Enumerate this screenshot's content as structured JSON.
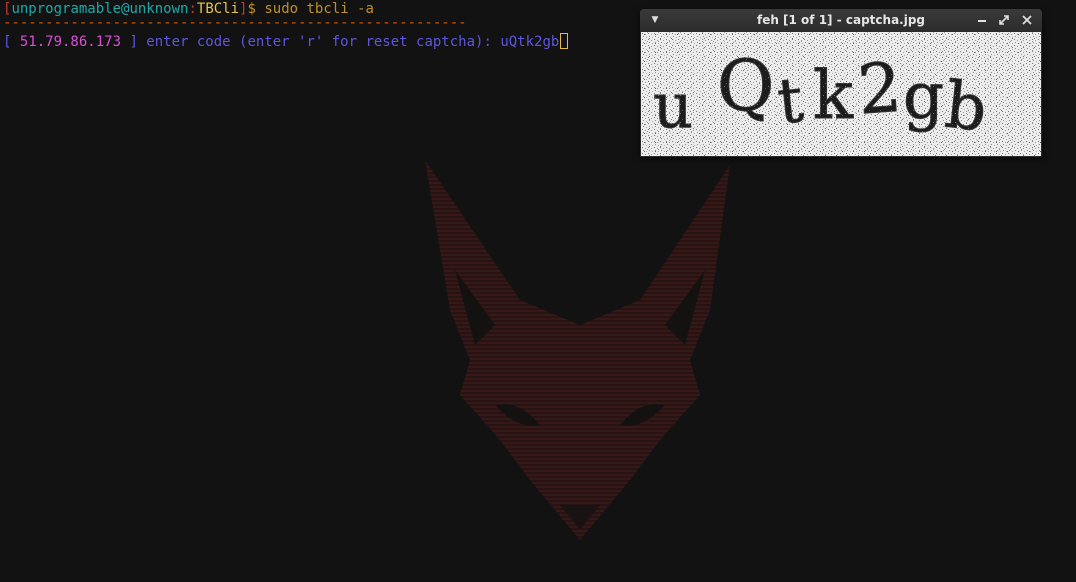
{
  "terminal": {
    "prompt_open_bracket": "[",
    "prompt_user_host": "unprogramable@unknown",
    "prompt_colon": ":",
    "prompt_dir": "TBCli",
    "prompt_close_bracket": "]",
    "prompt_symbol": "$",
    "command": " sudo tbcli -a",
    "separator": "-------------------------------------------------------",
    "ip_open": "[ ",
    "ip_address": "51.79.86.173",
    "ip_close": " ]",
    "prompt_text": " enter code (enter 'r' for reset captcha): ",
    "input_value": "uQtk2gb"
  },
  "feh_window": {
    "title": "feh [1 of 1] - captcha.jpg",
    "menu_icon": "triangle-down",
    "minimize_icon": "minimize",
    "maximize_icon": "maximize",
    "close_icon": "close"
  },
  "captcha": {
    "chars": [
      "u",
      "Q",
      "t",
      "k",
      "2",
      "g",
      "b"
    ]
  },
  "colors": {
    "background": "#121212",
    "prompt_user": "#21a8a8",
    "prompt_dir": "#e8c547",
    "command": "#c0912a",
    "ip": "#d84fd8",
    "prompt_text": "#5d55e0",
    "separator": "#d35400"
  }
}
